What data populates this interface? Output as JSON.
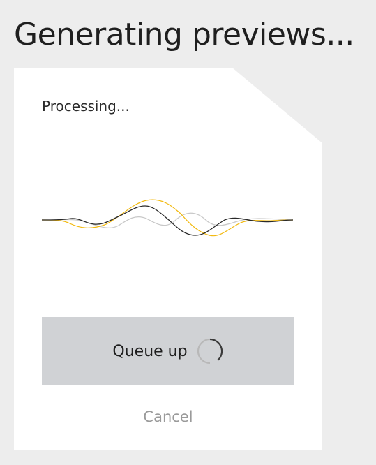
{
  "page": {
    "title": "Generating previews..."
  },
  "card": {
    "status_text": "Processing...",
    "queue_button_label": "Queue up",
    "cancel_label": "Cancel",
    "waveform_icon": "audio-waveform-icon",
    "spinner_icon": "loading-spinner-icon"
  },
  "colors": {
    "background": "#ededed",
    "card": "#ffffff",
    "button": "#d0d2d5",
    "wave_dark": "#2a2a2a",
    "wave_yellow": "#f2b90f",
    "wave_light": "#c8c8c8",
    "cancel_text": "#9a9a9a"
  }
}
